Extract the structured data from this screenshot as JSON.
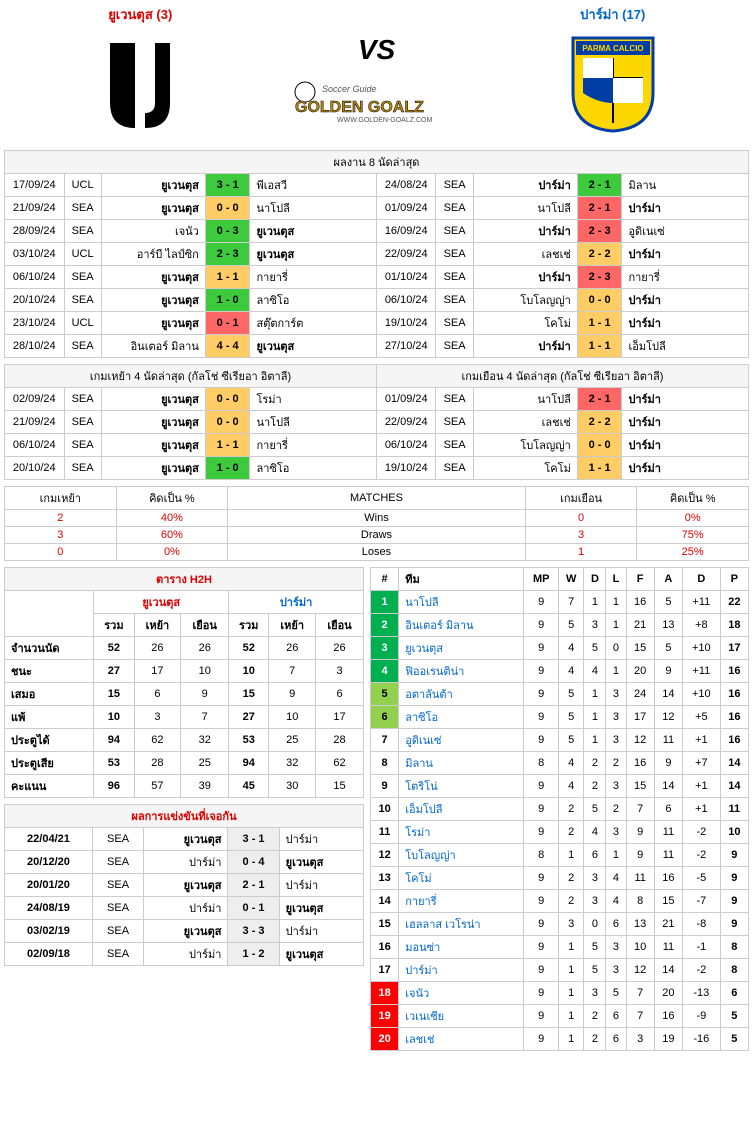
{
  "header": {
    "home_name": "ยูเวนตุส (3)",
    "away_name": "ปาร์ม่า (17)",
    "vs": "VS",
    "gg_label": "GOLDEN GOALZ",
    "gg_sub": "Soccer Guide"
  },
  "last8": {
    "title": "ผลงาน 8 นัดล่าสุด",
    "home": [
      {
        "d": "17/09/24",
        "c": "UCL",
        "h": "ยูเวนตุส",
        "s": "3 - 1",
        "cls": "bg-green",
        "a": "พีเอสวี"
      },
      {
        "d": "21/09/24",
        "c": "SEA",
        "h": "ยูเวนตุส",
        "s": "0 - 0",
        "cls": "bg-orange",
        "a": "นาโปลี"
      },
      {
        "d": "28/09/24",
        "c": "SEA",
        "h": "เจนัว",
        "s": "0 - 3",
        "cls": "bg-green",
        "a": "ยูเวนตุส"
      },
      {
        "d": "03/10/24",
        "c": "UCL",
        "h": "อาร์บี ไลป์ซิก",
        "s": "2 - 3",
        "cls": "bg-green",
        "a": "ยูเวนตุส"
      },
      {
        "d": "06/10/24",
        "c": "SEA",
        "h": "ยูเวนตุส",
        "s": "1 - 1",
        "cls": "bg-orange",
        "a": "กายารี่"
      },
      {
        "d": "20/10/24",
        "c": "SEA",
        "h": "ยูเวนตุส",
        "s": "1 - 0",
        "cls": "bg-green",
        "a": "ลาซิโอ"
      },
      {
        "d": "23/10/24",
        "c": "UCL",
        "h": "ยูเวนตุส",
        "s": "0 - 1",
        "cls": "bg-red",
        "a": "สตุ๊ตการ์ต"
      },
      {
        "d": "28/10/24",
        "c": "SEA",
        "h": "อินเตอร์ มิลาน",
        "s": "4 - 4",
        "cls": "bg-orange",
        "a": "ยูเวนตุส"
      }
    ],
    "away": [
      {
        "d": "24/08/24",
        "c": "SEA",
        "h": "ปาร์ม่า",
        "s": "2 - 1",
        "cls": "bg-green",
        "a": "มิลาน"
      },
      {
        "d": "01/09/24",
        "c": "SEA",
        "h": "นาโปลี",
        "s": "2 - 1",
        "cls": "bg-red",
        "a": "ปาร์ม่า"
      },
      {
        "d": "16/09/24",
        "c": "SEA",
        "h": "ปาร์ม่า",
        "s": "2 - 3",
        "cls": "bg-red",
        "a": "อูดิเนเซ่"
      },
      {
        "d": "22/09/24",
        "c": "SEA",
        "h": "เลชเช่",
        "s": "2 - 2",
        "cls": "bg-orange",
        "a": "ปาร์ม่า"
      },
      {
        "d": "01/10/24",
        "c": "SEA",
        "h": "ปาร์ม่า",
        "s": "2 - 3",
        "cls": "bg-red",
        "a": "กายารี่"
      },
      {
        "d": "06/10/24",
        "c": "SEA",
        "h": "โบโลญญ่า",
        "s": "0 - 0",
        "cls": "bg-orange",
        "a": "ปาร์ม่า"
      },
      {
        "d": "19/10/24",
        "c": "SEA",
        "h": "โคโม่",
        "s": "1 - 1",
        "cls": "bg-orange",
        "a": "ปาร์ม่า"
      },
      {
        "d": "27/10/24",
        "c": "SEA",
        "h": "ปาร์ม่า",
        "s": "1 - 1",
        "cls": "bg-orange",
        "a": "เอ็มโปลี"
      }
    ]
  },
  "last4": {
    "home_title": "เกมเหย้า 4 นัดล่าสุด (กัลโช่ ซีเรียอา อิตาลี)",
    "away_title": "เกมเยือน 4 นัดล่าสุด (กัลโช่ ซีเรียอา อิตาลี)",
    "home": [
      {
        "d": "02/09/24",
        "c": "SEA",
        "h": "ยูเวนตุส",
        "s": "0 - 0",
        "cls": "bg-orange",
        "a": "โรม่า"
      },
      {
        "d": "21/09/24",
        "c": "SEA",
        "h": "ยูเวนตุส",
        "s": "0 - 0",
        "cls": "bg-orange",
        "a": "นาโปลี"
      },
      {
        "d": "06/10/24",
        "c": "SEA",
        "h": "ยูเวนตุส",
        "s": "1 - 1",
        "cls": "bg-orange",
        "a": "กายารี่"
      },
      {
        "d": "20/10/24",
        "c": "SEA",
        "h": "ยูเวนตุส",
        "s": "1 - 0",
        "cls": "bg-green",
        "a": "ลาซิโอ"
      }
    ],
    "away": [
      {
        "d": "01/09/24",
        "c": "SEA",
        "h": "นาโปลี",
        "s": "2 - 1",
        "cls": "bg-red",
        "a": "ปาร์ม่า"
      },
      {
        "d": "22/09/24",
        "c": "SEA",
        "h": "เลชเช่",
        "s": "2 - 2",
        "cls": "bg-orange",
        "a": "ปาร์ม่า"
      },
      {
        "d": "06/10/24",
        "c": "SEA",
        "h": "โบโลญญ่า",
        "s": "0 - 0",
        "cls": "bg-orange",
        "a": "ปาร์ม่า"
      },
      {
        "d": "19/10/24",
        "c": "SEA",
        "h": "โคโม่",
        "s": "1 - 1",
        "cls": "bg-orange",
        "a": "ปาร์ม่า"
      }
    ]
  },
  "record": {
    "hdr_home": "เกมเหย้า",
    "hdr_pct": "คิดเป็น %",
    "hdr_match": "MATCHES",
    "hdr_away": "เกมเยือน",
    "rows": [
      {
        "hv": "2",
        "hp": "40%",
        "m": "Wins",
        "av": "0",
        "ap": "0%"
      },
      {
        "hv": "3",
        "hp": "60%",
        "m": "Draws",
        "av": "3",
        "ap": "75%"
      },
      {
        "hv": "0",
        "hp": "0%",
        "m": "Loses",
        "av": "1",
        "ap": "25%"
      }
    ]
  },
  "h2h": {
    "title": "ตาราง H2H",
    "home_name": "ยูเวนตุส",
    "away_name": "ปาร์ม่า",
    "sub": [
      "รวม",
      "เหย้า",
      "เยือน",
      "รวม",
      "เหย้า",
      "เยือน"
    ],
    "rows": [
      {
        "l": "จำนวนนัด",
        "v": [
          "52",
          "26",
          "26",
          "52",
          "26",
          "26"
        ]
      },
      {
        "l": "ชนะ",
        "v": [
          "27",
          "17",
          "10",
          "10",
          "7",
          "3"
        ]
      },
      {
        "l": "เสมอ",
        "v": [
          "15",
          "6",
          "9",
          "15",
          "9",
          "6"
        ]
      },
      {
        "l": "แพ้",
        "v": [
          "10",
          "3",
          "7",
          "27",
          "10",
          "17"
        ]
      },
      {
        "l": "ประตูได้",
        "v": [
          "94",
          "62",
          "32",
          "53",
          "25",
          "28"
        ]
      },
      {
        "l": "ประตูเสีย",
        "v": [
          "53",
          "28",
          "25",
          "94",
          "32",
          "62"
        ]
      },
      {
        "l": "คะแนน",
        "v": [
          "96",
          "57",
          "39",
          "45",
          "30",
          "15"
        ]
      }
    ]
  },
  "meet": {
    "title": "ผลการแข่งขันที่เจอกัน",
    "rows": [
      {
        "d": "22/04/21",
        "c": "SEA",
        "h": "ยูเวนตุส",
        "s": "3 - 1",
        "a": "ปาร์ม่า"
      },
      {
        "d": "20/12/20",
        "c": "SEA",
        "h": "ปาร์ม่า",
        "s": "0 - 4",
        "a": "ยูเวนตุส"
      },
      {
        "d": "20/01/20",
        "c": "SEA",
        "h": "ยูเวนตุส",
        "s": "2 - 1",
        "a": "ปาร์ม่า"
      },
      {
        "d": "24/08/19",
        "c": "SEA",
        "h": "ปาร์ม่า",
        "s": "0 - 1",
        "a": "ยูเวนตุส"
      },
      {
        "d": "03/02/19",
        "c": "SEA",
        "h": "ยูเวนตุส",
        "s": "3 - 3",
        "a": "ปาร์ม่า"
      },
      {
        "d": "02/09/18",
        "c": "SEA",
        "h": "ปาร์ม่า",
        "s": "1 - 2",
        "a": "ยูเวนตุส"
      }
    ]
  },
  "table": {
    "hdr": [
      "#",
      "ทีม",
      "MP",
      "W",
      "D",
      "L",
      "F",
      "A",
      "D",
      "P"
    ],
    "rows": [
      {
        "r": "1",
        "rc": "rank-g",
        "t": "นาโปลี",
        "v": [
          "9",
          "7",
          "1",
          "1",
          "16",
          "5",
          "+11",
          "22"
        ]
      },
      {
        "r": "2",
        "rc": "rank-g",
        "t": "อินเตอร์ มิลาน",
        "v": [
          "9",
          "5",
          "3",
          "1",
          "21",
          "13",
          "+8",
          "18"
        ]
      },
      {
        "r": "3",
        "rc": "rank-g",
        "t": "ยูเวนตุส",
        "v": [
          "9",
          "4",
          "5",
          "0",
          "15",
          "5",
          "+10",
          "17"
        ]
      },
      {
        "r": "4",
        "rc": "rank-g",
        "t": "ฟิออเรนติน่า",
        "v": [
          "9",
          "4",
          "4",
          "1",
          "20",
          "9",
          "+11",
          "16"
        ]
      },
      {
        "r": "5",
        "rc": "rank-lg",
        "t": "อตาลันต้า",
        "v": [
          "9",
          "5",
          "1",
          "3",
          "24",
          "14",
          "+10",
          "16"
        ]
      },
      {
        "r": "6",
        "rc": "rank-lg",
        "t": "ลาซิโอ",
        "v": [
          "9",
          "5",
          "1",
          "3",
          "17",
          "12",
          "+5",
          "16"
        ]
      },
      {
        "r": "7",
        "rc": "",
        "t": "อูดิเนเซ่",
        "v": [
          "9",
          "5",
          "1",
          "3",
          "12",
          "11",
          "+1",
          "16"
        ]
      },
      {
        "r": "8",
        "rc": "",
        "t": "มิลาน",
        "v": [
          "8",
          "4",
          "2",
          "2",
          "16",
          "9",
          "+7",
          "14"
        ]
      },
      {
        "r": "9",
        "rc": "",
        "t": "โตริโน่",
        "v": [
          "9",
          "4",
          "2",
          "3",
          "15",
          "14",
          "+1",
          "14"
        ]
      },
      {
        "r": "10",
        "rc": "",
        "t": "เอ็มโปลี",
        "v": [
          "9",
          "2",
          "5",
          "2",
          "7",
          "6",
          "+1",
          "11"
        ]
      },
      {
        "r": "11",
        "rc": "",
        "t": "โรม่า",
        "v": [
          "9",
          "2",
          "4",
          "3",
          "9",
          "11",
          "-2",
          "10"
        ]
      },
      {
        "r": "12",
        "rc": "",
        "t": "โบโลญญ่า",
        "v": [
          "8",
          "1",
          "6",
          "1",
          "9",
          "11",
          "-2",
          "9"
        ]
      },
      {
        "r": "13",
        "rc": "",
        "t": "โคโม่",
        "v": [
          "9",
          "2",
          "3",
          "4",
          "11",
          "16",
          "-5",
          "9"
        ]
      },
      {
        "r": "14",
        "rc": "",
        "t": "กายารี่",
        "v": [
          "9",
          "2",
          "3",
          "4",
          "8",
          "15",
          "-7",
          "9"
        ]
      },
      {
        "r": "15",
        "rc": "",
        "t": "เฮลลาส เวโรน่า",
        "v": [
          "9",
          "3",
          "0",
          "6",
          "13",
          "21",
          "-8",
          "9"
        ]
      },
      {
        "r": "16",
        "rc": "",
        "t": "มอนซ่า",
        "v": [
          "9",
          "1",
          "5",
          "3",
          "10",
          "11",
          "-1",
          "8"
        ]
      },
      {
        "r": "17",
        "rc": "",
        "t": "ปาร์ม่า",
        "v": [
          "9",
          "1",
          "5",
          "3",
          "12",
          "14",
          "-2",
          "8"
        ]
      },
      {
        "r": "18",
        "rc": "rank-r",
        "t": "เจนัว",
        "v": [
          "9",
          "1",
          "3",
          "5",
          "7",
          "20",
          "-13",
          "6"
        ]
      },
      {
        "r": "19",
        "rc": "rank-r",
        "t": "เวเนเซีย",
        "v": [
          "9",
          "1",
          "2",
          "6",
          "7",
          "16",
          "-9",
          "5"
        ]
      },
      {
        "r": "20",
        "rc": "rank-r",
        "t": "เลชเช่",
        "v": [
          "9",
          "1",
          "2",
          "6",
          "3",
          "19",
          "-16",
          "5"
        ]
      }
    ]
  }
}
